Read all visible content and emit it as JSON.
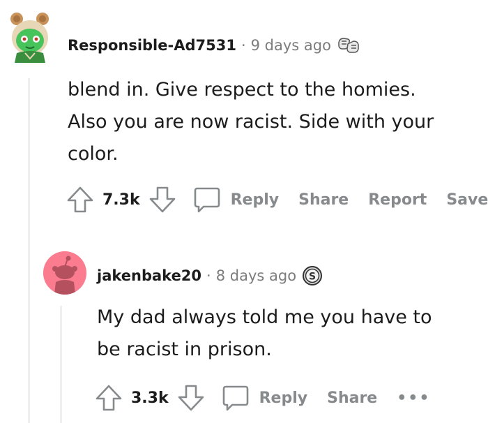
{
  "comments": [
    {
      "username": "Responsible-Ad7531",
      "separator": "·",
      "time": "9 days ago",
      "award_icon": "fist-bump-award-icon",
      "body_lines": [
        "blend in. Give respect to the homies.",
        "Also you are now racist. Side with your",
        "color."
      ],
      "score": "7.3k",
      "actions": {
        "reply": "Reply",
        "share": "Share",
        "report": "Report",
        "save": "Save"
      }
    },
    {
      "username": "jakenbake20",
      "separator": "·",
      "time": "8 days ago",
      "award_icon": "silver-coin-award-icon",
      "body_lines": [
        "My dad always told me you have to",
        "be racist in prison."
      ],
      "score": "3.3k",
      "actions": {
        "reply": "Reply",
        "share": "Share",
        "more": "•••"
      }
    }
  ],
  "colors": {
    "thread_line": "#edeff1",
    "action_gray": "#878a8c",
    "meta_gray": "#7c7c7c",
    "avatar2_bg": "#fb7b8f",
    "avatar1_face": "#46c35b"
  }
}
